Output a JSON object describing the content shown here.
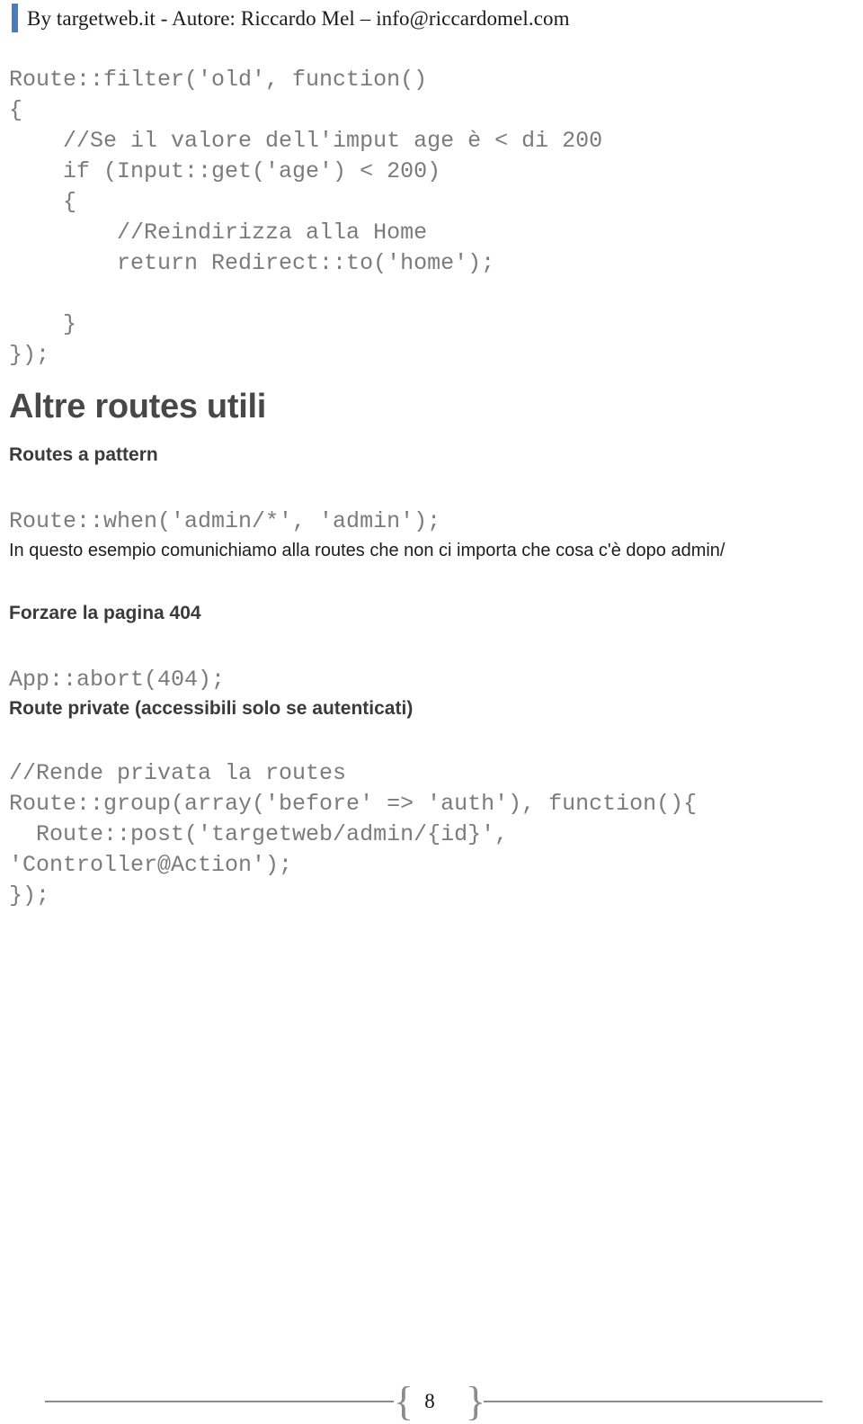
{
  "header": {
    "text": "By targetweb.it  - Autore: Riccardo Mel – info@riccardomel.com",
    "accent_color": "#4a7ebb"
  },
  "code_block_filter": {
    "lines": [
      "Route::filter('old', function()",
      "{",
      "    //Se il valore dell'imput age è < di 200",
      "    if (Input::get('age') < 200)",
      "    {",
      "        //Reindirizza alla Home",
      "        return Redirect::to('home');",
      "",
      "    }",
      "});"
    ]
  },
  "section_altre_routes": {
    "title": "Altre routes utili"
  },
  "section_pattern": {
    "subtitle": "Routes a pattern",
    "code": "Route::when('admin/*', 'admin');",
    "description": "In questo esempio comunichiamo alla routes che non ci importa che cosa c'è dopo admin/"
  },
  "section_404": {
    "subtitle": "Forzare la pagina 404",
    "code": "App::abort(404);"
  },
  "section_private": {
    "subtitle": "Route private (accessibili solo se autenticati)",
    "lines": [
      "//Rende privata la routes",
      "Route::group(array('before' => 'auth'), function(){",
      "  Route::post('targetweb/admin/{id}',",
      "'Controller@Action');",
      "});"
    ]
  },
  "footer": {
    "page_number": "8",
    "brace_left": "{",
    "brace_right": "}",
    "rule_color": "#8c8c8c"
  }
}
